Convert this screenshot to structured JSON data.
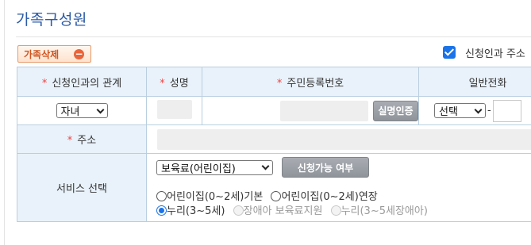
{
  "section_title": "가족구성원",
  "delete_button": {
    "label": "가족삭제",
    "icon": "minus-circle-icon"
  },
  "same_address": {
    "checked": true,
    "label": "신청인과 주소"
  },
  "columns": {
    "relation": "신청인과의 관계",
    "name": "성명",
    "rrn": "주민등록번호",
    "phone": "일반전화"
  },
  "row": {
    "relation_value": "자녀",
    "verify_button": "실명인증",
    "phone_select": "선택",
    "phone_dash": "-"
  },
  "address": {
    "label": "주소"
  },
  "service": {
    "label": "서비스 선택",
    "select_value": "보육료(어린이집)",
    "check_button": "신청가능 여부",
    "options": [
      {
        "label": "어린이집(0~2세)기본",
        "selected": false,
        "disabled": false
      },
      {
        "label": "어린이집(0~2세)연장",
        "selected": false,
        "disabled": false
      },
      {
        "label": "누리(3~5세)",
        "selected": true,
        "disabled": false
      },
      {
        "label": "장애아 보육료지원",
        "selected": false,
        "disabled": true
      },
      {
        "label": "누리(3~5세장애아)",
        "selected": false,
        "disabled": true
      }
    ]
  },
  "colors": {
    "accent": "#2b5aa6",
    "header_bg": "#e9f2fa",
    "border": "#b9cfe0",
    "required": "#ee4444"
  }
}
